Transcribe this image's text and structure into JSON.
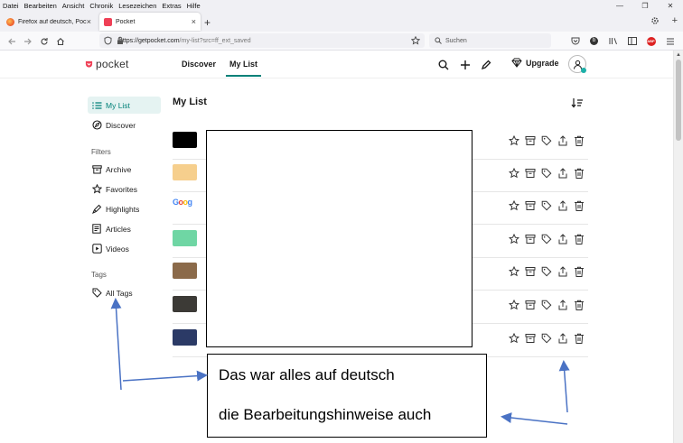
{
  "menubar": {
    "items": [
      "Datei",
      "Bearbeiten",
      "Ansicht",
      "Chronik",
      "Lesezeichen",
      "Extras",
      "Hilfe"
    ]
  },
  "tabs": [
    {
      "label": "Firefox auf deutsch, Pocket auf d",
      "close": "×"
    },
    {
      "label": "Pocket",
      "close": "×"
    }
  ],
  "newtab": "+",
  "window_controls": [
    "—",
    "❐",
    "✕"
  ],
  "urlbar": {
    "host": "https://getpocket.com",
    "path": "/my-list?src=ff_ext_saved"
  },
  "searchbar": {
    "placeholder": "Suchen"
  },
  "pocket": {
    "logo": "pocket",
    "nav": [
      "Discover",
      "My List"
    ],
    "upgrade": "Upgrade"
  },
  "sidebar": {
    "items": [
      {
        "label": "My List",
        "icon": "list-icon",
        "selected": true
      },
      {
        "label": "Discover",
        "icon": "compass-icon",
        "selected": false
      }
    ],
    "filters_heading": "Filters",
    "filters": [
      {
        "label": "Archive",
        "icon": "archive-icon"
      },
      {
        "label": "Favorites",
        "icon": "star-icon"
      },
      {
        "label": "Highlights",
        "icon": "highlighter-icon"
      },
      {
        "label": "Articles",
        "icon": "article-icon"
      },
      {
        "label": "Videos",
        "icon": "video-icon"
      }
    ],
    "tags_heading": "Tags",
    "tags": [
      {
        "label": "All Tags",
        "icon": "tag-icon"
      }
    ]
  },
  "main": {
    "title": "My List",
    "rows": [
      {
        "thumb_color": "#000000"
      },
      {
        "thumb_color": "#f6cf8d"
      },
      {
        "thumb_color": "google"
      },
      {
        "thumb_color": "#6fd6a4"
      },
      {
        "thumb_color": "#8b6a4a"
      },
      {
        "thumb_color": "#3c3a36"
      },
      {
        "thumb_color": "#2b3a66"
      }
    ]
  },
  "annotation": {
    "line1": "Das war alles auf deutsch",
    "line2": "die Bearbeitungshinweise auch"
  },
  "colors": {
    "accent": "#008078",
    "pocket_red": "#ef4056",
    "arrow": "#4a72c4"
  }
}
